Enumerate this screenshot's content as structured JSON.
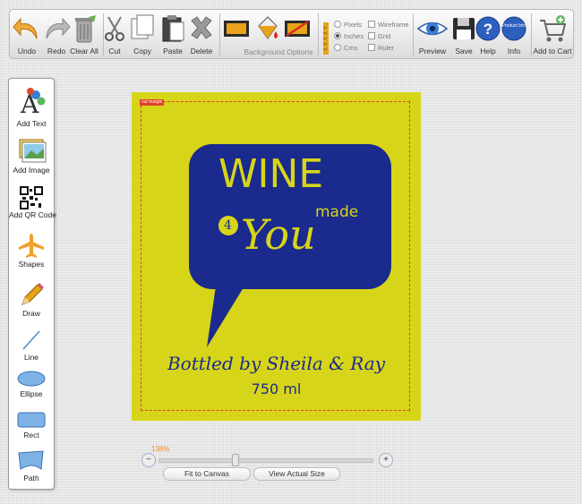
{
  "toolbar": {
    "undo": "Undo",
    "redo": "Redo",
    "clear_all": "Clear All",
    "cut": "Cut",
    "copy": "Copy",
    "paste": "Paste",
    "delete": "Delete",
    "background_options": "Background Options",
    "units": {
      "pixels": "Pixels",
      "inches": "Inches",
      "cms": "Cms",
      "selected": "inches"
    },
    "view": {
      "wireframe": "Wireframe",
      "grid": "Grid",
      "ruler": "Ruler"
    },
    "preview": "Preview",
    "save": "Save",
    "help": "Help",
    "info": "Info",
    "product_info_badge": "Product Info",
    "add_to_cart": "Add to Cart"
  },
  "side_tools": [
    {
      "label": "Add Text",
      "icon": "add-text-icon"
    },
    {
      "label": "Add Image",
      "icon": "add-image-icon"
    },
    {
      "label": "Add QR Code",
      "icon": "qr-code-icon"
    },
    {
      "label": "Shapes",
      "icon": "airplane-icon"
    },
    {
      "label": "Draw",
      "icon": "pencil-icon"
    },
    {
      "label": "Line",
      "icon": "line-icon"
    },
    {
      "label": "Ellipse",
      "icon": "ellipse-icon"
    },
    {
      "label": "Rect",
      "icon": "rect-icon"
    },
    {
      "label": "Path",
      "icon": "path-icon"
    }
  ],
  "canvas": {
    "cut_margin_label": "cut margin",
    "wine": "WINE",
    "made": "made",
    "four": "4",
    "you": "You",
    "bottled": "Bottled by Sheila & Ray",
    "volume": "750 ml",
    "colors": {
      "label_bg": "#d7d519",
      "bubble": "#1b2a8d",
      "cut_line": "#e0402a"
    }
  },
  "zoom": {
    "percent": "136%",
    "level_fraction": 0.36,
    "fit_to_canvas": "Fit to Canvas",
    "view_actual_size": "View Actual Size"
  }
}
